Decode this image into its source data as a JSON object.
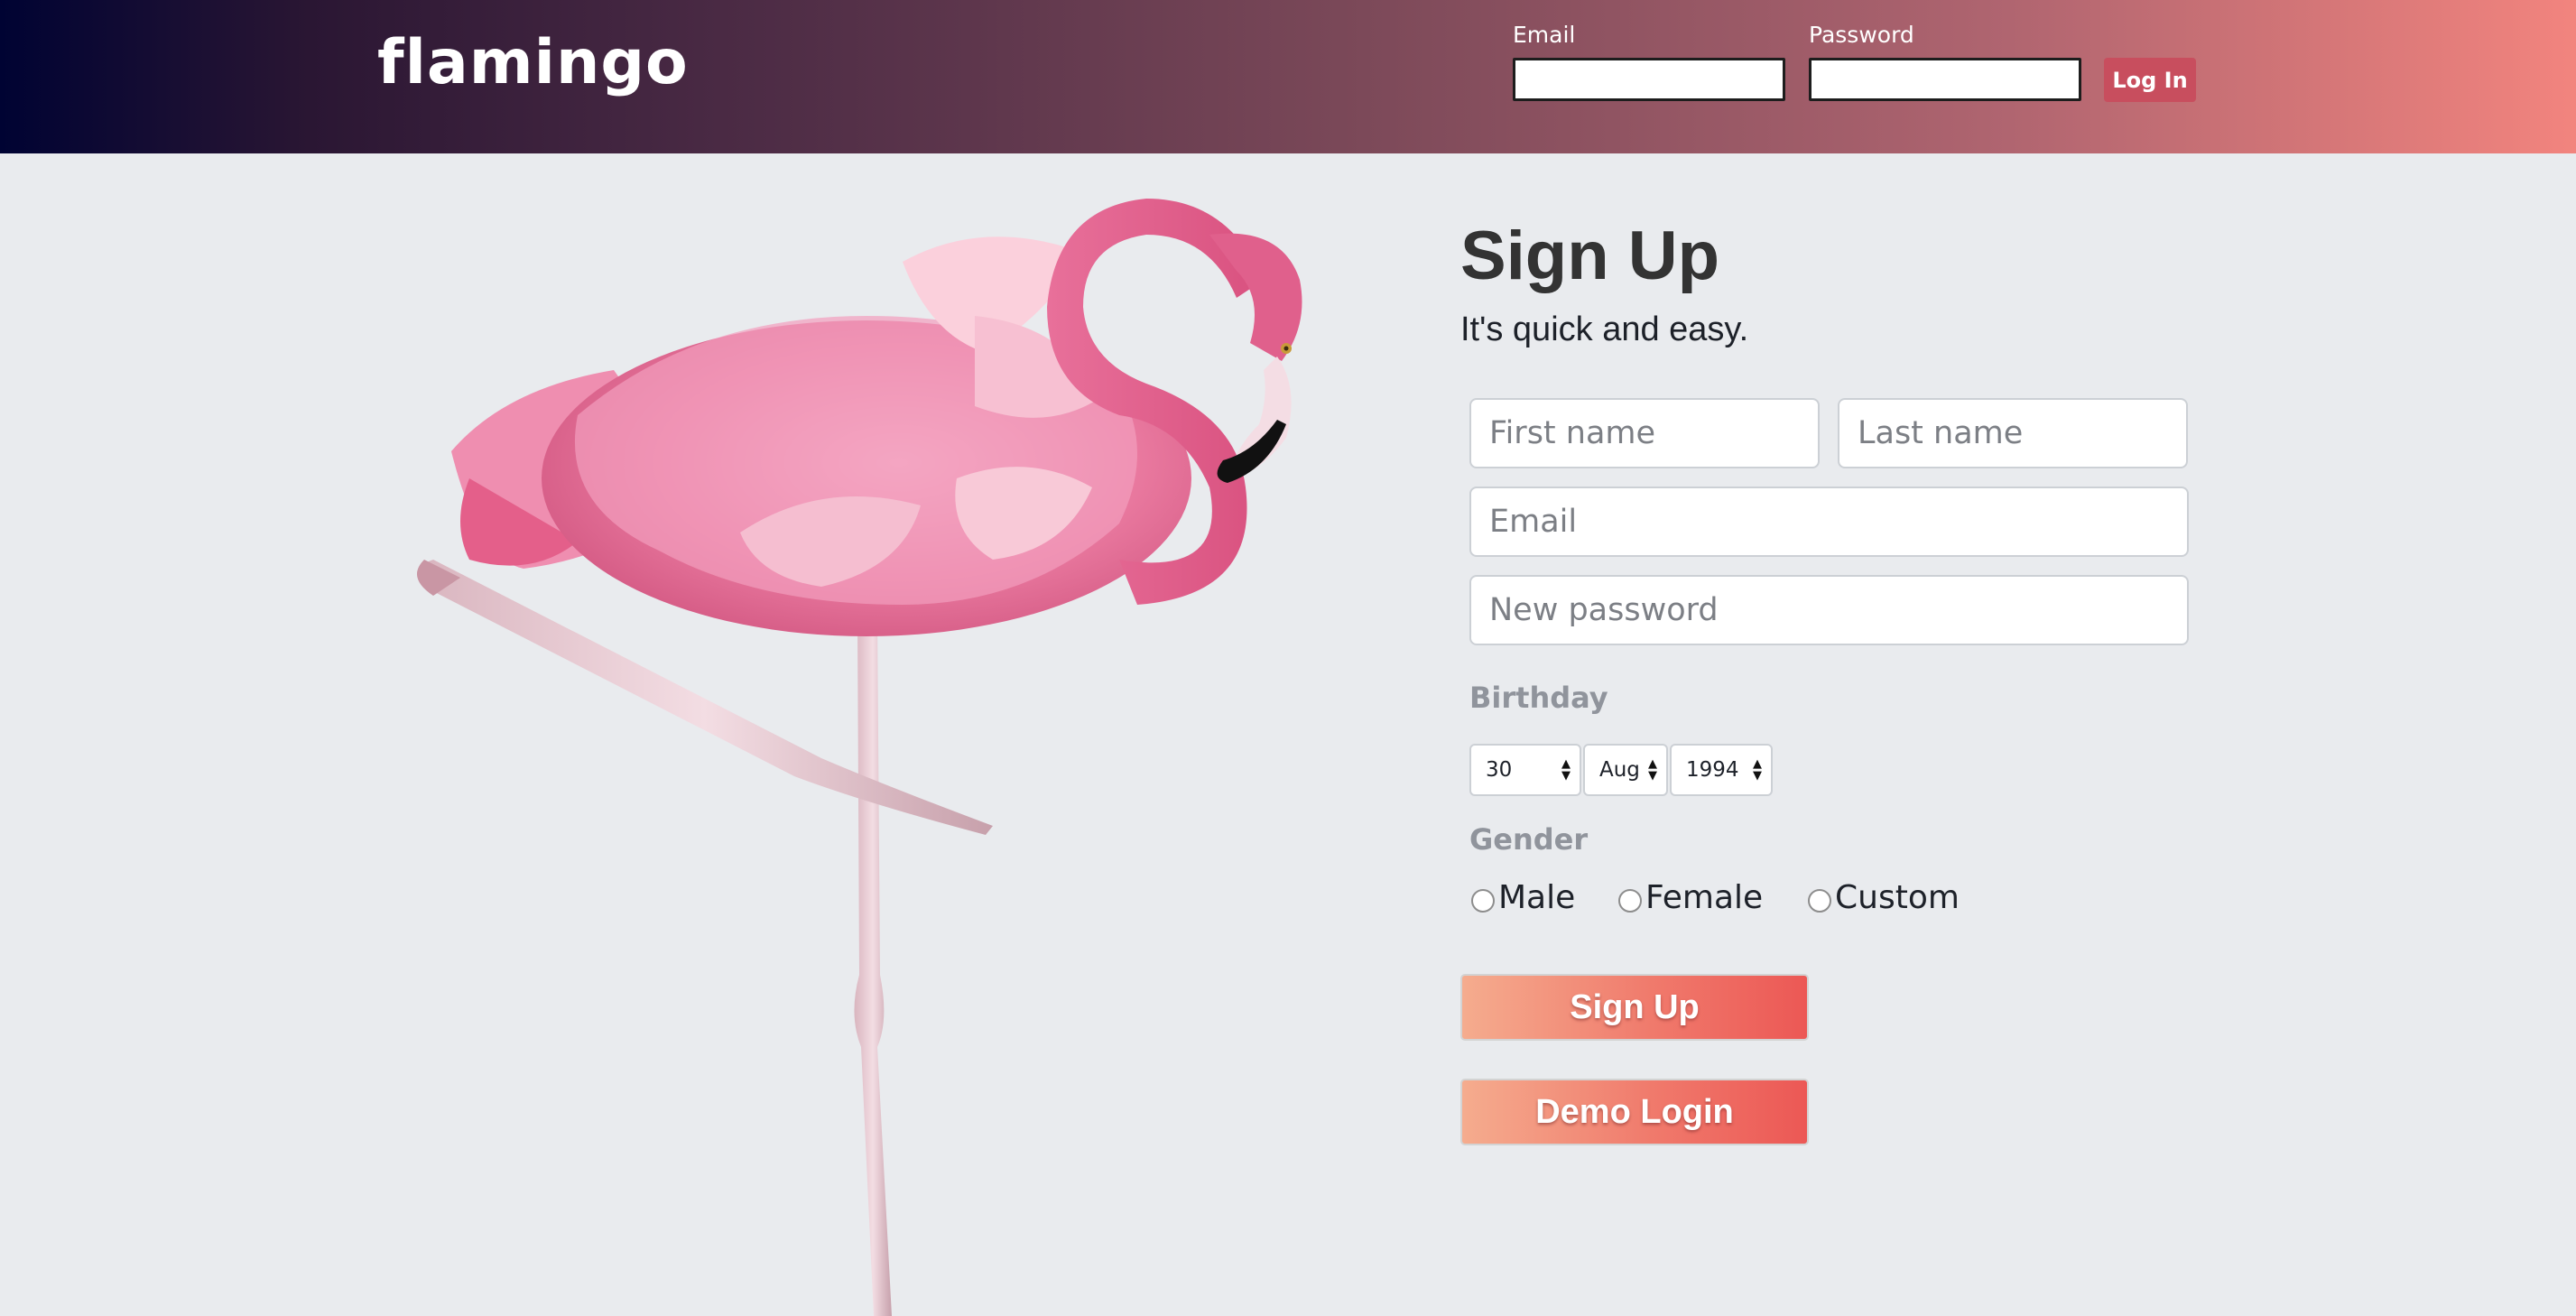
{
  "header": {
    "logo": "flamingo",
    "email_label": "Email",
    "password_label": "Password",
    "email_value": "",
    "password_value": "",
    "login_label": "Log In"
  },
  "hero": {
    "image": "flamingo-illustration"
  },
  "signup": {
    "title": "Sign Up",
    "subtitle": "It's quick and easy.",
    "first_name_placeholder": "First name",
    "last_name_placeholder": "Last name",
    "email_placeholder": "Email",
    "password_placeholder": "New password",
    "birthday_label": "Birthday",
    "birthday": {
      "day": "30",
      "month": "Aug",
      "year": "1994"
    },
    "gender_label": "Gender",
    "gender_options": [
      "Male",
      "Female",
      "Custom"
    ],
    "submit_label": "Sign Up",
    "demo_label": "Demo Login"
  },
  "colors": {
    "header_start": "#000333",
    "header_end": "#f2847e",
    "login_button": "#c84e5e",
    "background": "#e9ebee",
    "button_start": "#f5ac8e",
    "button_end": "#ec5855"
  }
}
